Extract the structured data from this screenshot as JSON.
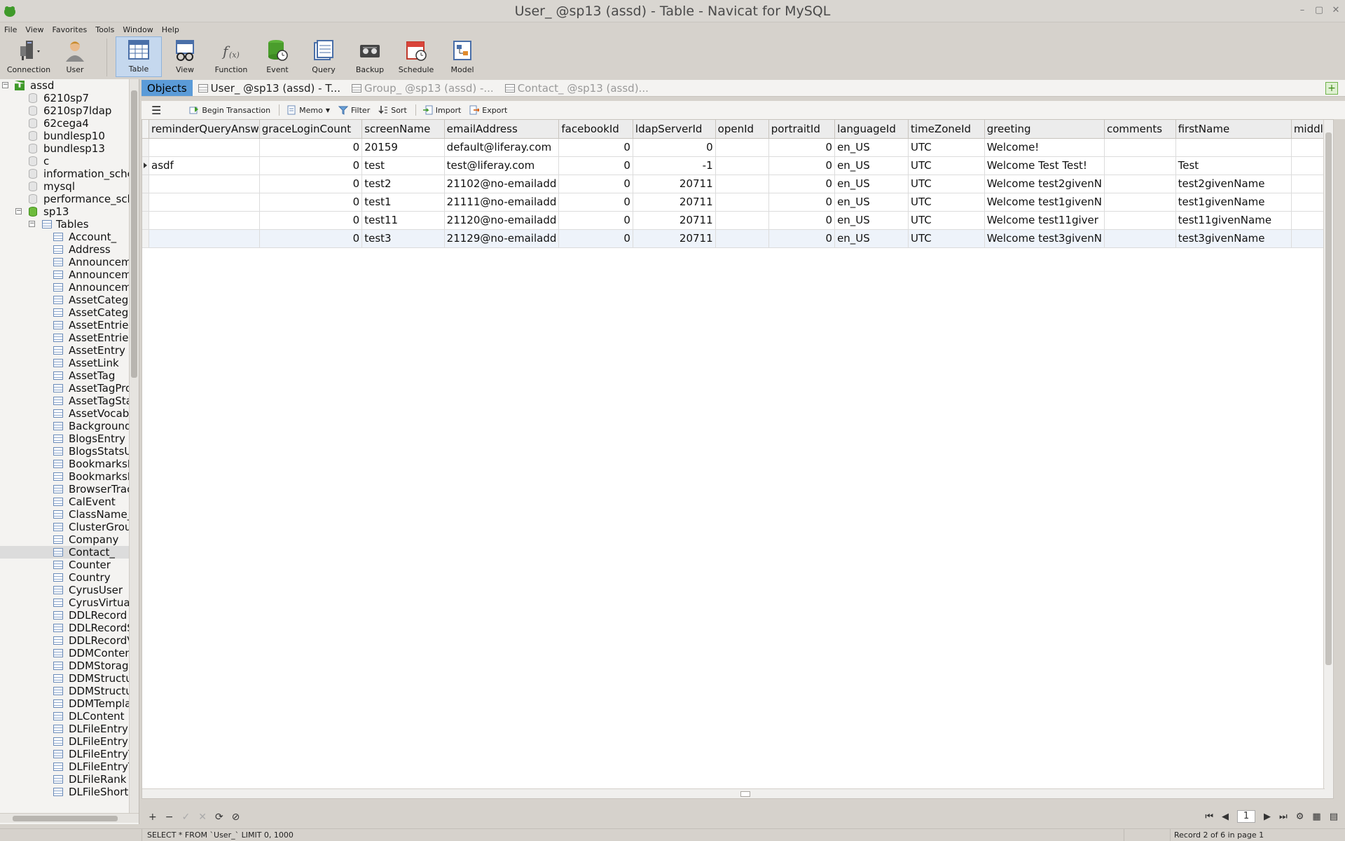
{
  "window": {
    "title": "User_ @sp13 (assd) - Table - Navicat for MySQL"
  },
  "menu": [
    "File",
    "View",
    "Favorites",
    "Tools",
    "Window",
    "Help"
  ],
  "toolbar": [
    {
      "label": "Connection",
      "icon": "connection-icon"
    },
    {
      "label": "User",
      "icon": "user-icon"
    },
    {
      "label": "Table",
      "icon": "table-icon",
      "active": true
    },
    {
      "label": "View",
      "icon": "view-icon"
    },
    {
      "label": "Function",
      "icon": "function-icon"
    },
    {
      "label": "Event",
      "icon": "event-icon"
    },
    {
      "label": "Query",
      "icon": "query-icon"
    },
    {
      "label": "Backup",
      "icon": "backup-icon"
    },
    {
      "label": "Schedule",
      "icon": "schedule-icon"
    },
    {
      "label": "Model",
      "icon": "model-icon"
    }
  ],
  "tree": {
    "connection": "assd",
    "databases": [
      "6210sp7",
      "6210sp7ldap",
      "62cega4",
      "bundlesp10",
      "bundlesp13",
      "c",
      "information_sche",
      "mysql",
      "performance_sch"
    ],
    "open_db": "sp13",
    "tables_folder": "Tables",
    "tables": [
      "Account_",
      "Address",
      "Announcem",
      "Announcem",
      "Announcem",
      "AssetCatego",
      "AssetCatego",
      "AssetEntries",
      "AssetEntries",
      "AssetEntry",
      "AssetLink",
      "AssetTag",
      "AssetTagPro",
      "AssetTagSta",
      "AssetVocabu",
      "Background",
      "BlogsEntry",
      "BlogsStatsUs",
      "BookmarksE",
      "BookmarksF",
      "BrowserTrac",
      "CalEvent",
      "ClassName_",
      "ClusterGrou",
      "Company",
      "Contact_",
      "Counter",
      "Country",
      "CyrusUser",
      "CyrusVirtual",
      "DDLRecord",
      "DDLRecordS",
      "DDLRecordV",
      "DDMConten",
      "DDMStorage",
      "DDMStructu",
      "DDMStructu",
      "DDMTempla",
      "DLContent",
      "DLFileEntry",
      "DLFileEntryM",
      "DLFileEntryT",
      "DLFileEntryT",
      "DLFileRank",
      "DLFileShortc"
    ],
    "selected_table": "Contact_"
  },
  "tabs": [
    {
      "label": "Objects"
    },
    {
      "label": "User_ @sp13 (assd) - T..."
    },
    {
      "label": "Group_ @sp13 (assd) -..."
    },
    {
      "label": "Contact_ @sp13 (assd)..."
    }
  ],
  "objbar": {
    "begin_transaction": "Begin Transaction",
    "memo": "Memo",
    "filter": "Filter",
    "sort": "Sort",
    "import": "Import",
    "export": "Export"
  },
  "grid": {
    "columns": [
      "reminderQueryAnsw",
      "graceLoginCount",
      "screenName",
      "emailAddress",
      "facebookId",
      "ldapServerId",
      "openId",
      "portraitId",
      "languageId",
      "timeZoneId",
      "greeting",
      "comments",
      "firstName",
      "middle"
    ],
    "rows": [
      [
        "",
        "0",
        "20159",
        "default@liferay.com",
        "0",
        "0",
        "",
        "0",
        "en_US",
        "UTC",
        "Welcome!",
        "",
        "",
        ""
      ],
      [
        "asdf",
        "0",
        "test",
        "test@liferay.com",
        "0",
        "-1",
        "",
        "0",
        "en_US",
        "UTC",
        "Welcome Test Test!",
        "",
        "Test",
        ""
      ],
      [
        "",
        "0",
        "test2",
        "21102@no-emailadd",
        "0",
        "20711",
        "",
        "0",
        "en_US",
        "UTC",
        "Welcome test2givenN",
        "",
        "test2givenName",
        ""
      ],
      [
        "",
        "0",
        "test1",
        "21111@no-emailadd",
        "0",
        "20711",
        "",
        "0",
        "en_US",
        "UTC",
        "Welcome test1givenN",
        "",
        "test1givenName",
        ""
      ],
      [
        "",
        "0",
        "test11",
        "21120@no-emailadd",
        "0",
        "20711",
        "",
        "0",
        "en_US",
        "UTC",
        "Welcome test11giver",
        "",
        "test11givenName",
        ""
      ],
      [
        "",
        "0",
        "test3",
        "21129@no-emailadd",
        "0",
        "20711",
        "",
        "0",
        "en_US",
        "UTC",
        "Welcome test3givenN",
        "",
        "test3givenName",
        ""
      ]
    ],
    "current_row": 1
  },
  "nav": {
    "page": "1"
  },
  "status": {
    "sql": "SELECT * FROM `User_` LIMIT 0, 1000",
    "record": "Record 2 of 6 in page 1"
  }
}
